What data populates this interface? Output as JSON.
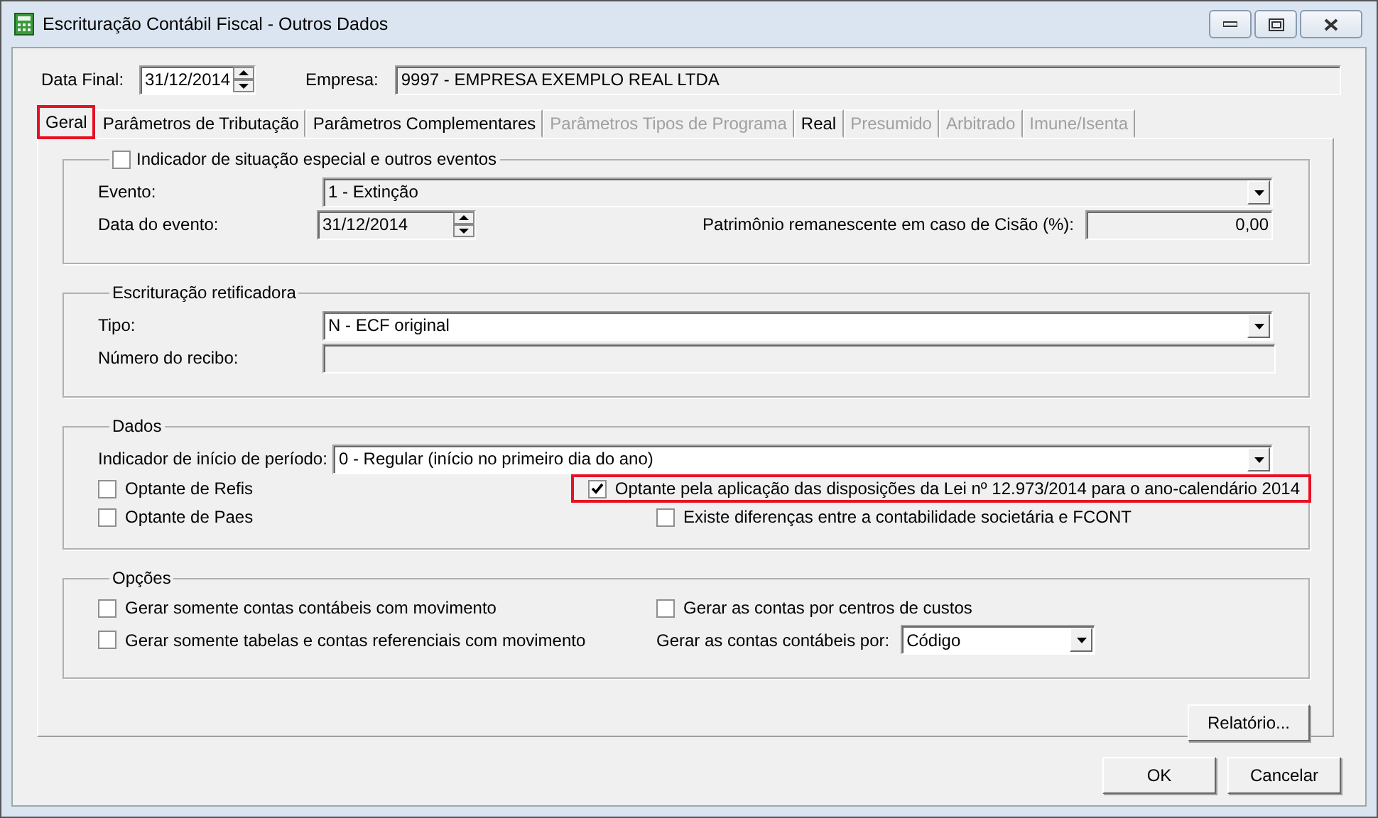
{
  "window": {
    "title": "Escrituração Contábil Fiscal - Outros Dados"
  },
  "header": {
    "data_final": {
      "label": "Data Final:",
      "value": "31/12/2014"
    },
    "empresa": {
      "label": "Empresa:",
      "value": "9997 - EMPRESA EXEMPLO REAL LTDA"
    }
  },
  "tabs": [
    {
      "label": "Geral",
      "selected": true,
      "disabled": false,
      "highlighted": true
    },
    {
      "label": "Parâmetros de Tributação",
      "selected": false,
      "disabled": false,
      "highlighted": false
    },
    {
      "label": "Parâmetros Complementares",
      "selected": false,
      "disabled": false,
      "highlighted": false
    },
    {
      "label": "Parâmetros Tipos de Programa",
      "selected": false,
      "disabled": true,
      "highlighted": false
    },
    {
      "label": "Real",
      "selected": false,
      "disabled": false,
      "highlighted": false
    },
    {
      "label": "Presumido",
      "selected": false,
      "disabled": true,
      "highlighted": false
    },
    {
      "label": "Arbitrado",
      "selected": false,
      "disabled": true,
      "highlighted": false
    },
    {
      "label": "Imune/Isenta",
      "selected": false,
      "disabled": true,
      "highlighted": false
    }
  ],
  "groups": [
    {
      "title": "Indicador de situação especial e outros eventos",
      "title_checked": false,
      "rows": [
        [
          {
            "kind": "combo",
            "label": "Evento:",
            "value": "1 - Extinção",
            "disabled": true
          }
        ],
        [
          {
            "kind": "spin",
            "label": "Data do evento:",
            "value": "31/12/2014",
            "disabled": true
          },
          {
            "kind": "text",
            "label": "Patrimônio remanescente em caso de Cisão (%):",
            "value": "0,00",
            "disabled": true
          }
        ]
      ]
    },
    {
      "title": "Escrituração retificadora",
      "rows": [
        [
          {
            "kind": "combo",
            "label": "Tipo:",
            "value": "N - ECF original",
            "disabled": false
          }
        ],
        [
          {
            "kind": "text",
            "label": "Número do recibo:",
            "disabled": true
          }
        ]
      ]
    },
    {
      "title": "Dados",
      "rows": [
        [
          {
            "kind": "combo",
            "label": "Indicador de início de período:",
            "value": "0 - Regular (início no primeiro dia do ano)",
            "disabled": false
          }
        ],
        [
          {
            "kind": "checkbox",
            "label": "Optante de Refis",
            "checked": false,
            "highlighted": false
          },
          {
            "kind": "checkbox",
            "label": "Optante pela aplicação das disposições da Lei nº 12.973/2014 para o ano-calendário 2014",
            "checked": true,
            "highlighted": true
          }
        ],
        [
          {
            "kind": "checkbox",
            "label": "Optante de Paes",
            "checked": false,
            "highlighted": false
          },
          {
            "kind": "checkbox",
            "label": "Existe diferenças entre a contabilidade societária e FCONT",
            "checked": false,
            "highlighted": false
          }
        ]
      ]
    },
    {
      "title": "Opções",
      "rows": [
        [
          {
            "kind": "checkbox",
            "label": "Gerar somente contas contábeis com movimento",
            "checked": false,
            "highlighted": false
          },
          {
            "kind": "checkbox",
            "label": "Gerar as contas por centros de custos",
            "checked": false,
            "highlighted": false
          }
        ],
        [
          {
            "kind": "checkbox",
            "label": "Gerar somente tabelas e contas referenciais com movimento",
            "checked": false,
            "highlighted": false
          },
          {
            "kind": "combo",
            "label": "Gerar as contas contábeis por:",
            "value": "Código",
            "disabled": false
          }
        ]
      ]
    }
  ],
  "report_button": "Relatório...",
  "buttons": [
    "OK",
    "Cancelar"
  ]
}
